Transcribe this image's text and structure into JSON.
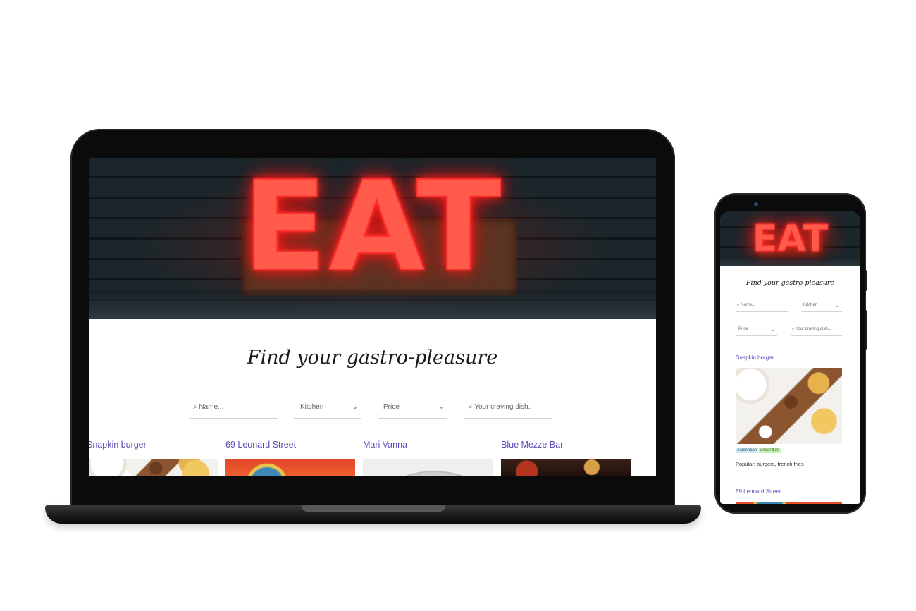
{
  "hero": {
    "sign_text": "EAT"
  },
  "tagline": "Find your gastro-pleasure",
  "filters": {
    "name_placeholder": "⌕ Name...",
    "kitchen_label": "Kitchen",
    "price_label": "Price",
    "dish_placeholder": "⌕ Your craving dish...",
    "chevron": "⌄"
  },
  "restaurants": [
    {
      "name": "Snapkin burger",
      "image": "burger-board-photo"
    },
    {
      "name": "69 Leonard Street",
      "image": "orange-dish-photo"
    },
    {
      "name": "Mari Vanna",
      "image": "plate-photo"
    },
    {
      "name": "Blue Mezze Bar",
      "image": "dark-bar-photo"
    }
  ],
  "mobile": {
    "first_restaurant": "Snapkin burger",
    "tags": [
      "#american",
      "under $30"
    ],
    "popular": "Popular: burgers, french fries",
    "second_restaurant": "69 Leonard Street"
  },
  "colors": {
    "link": "#5b4db7",
    "neon": "#ff2d2d",
    "device": "#0b0b0b"
  }
}
